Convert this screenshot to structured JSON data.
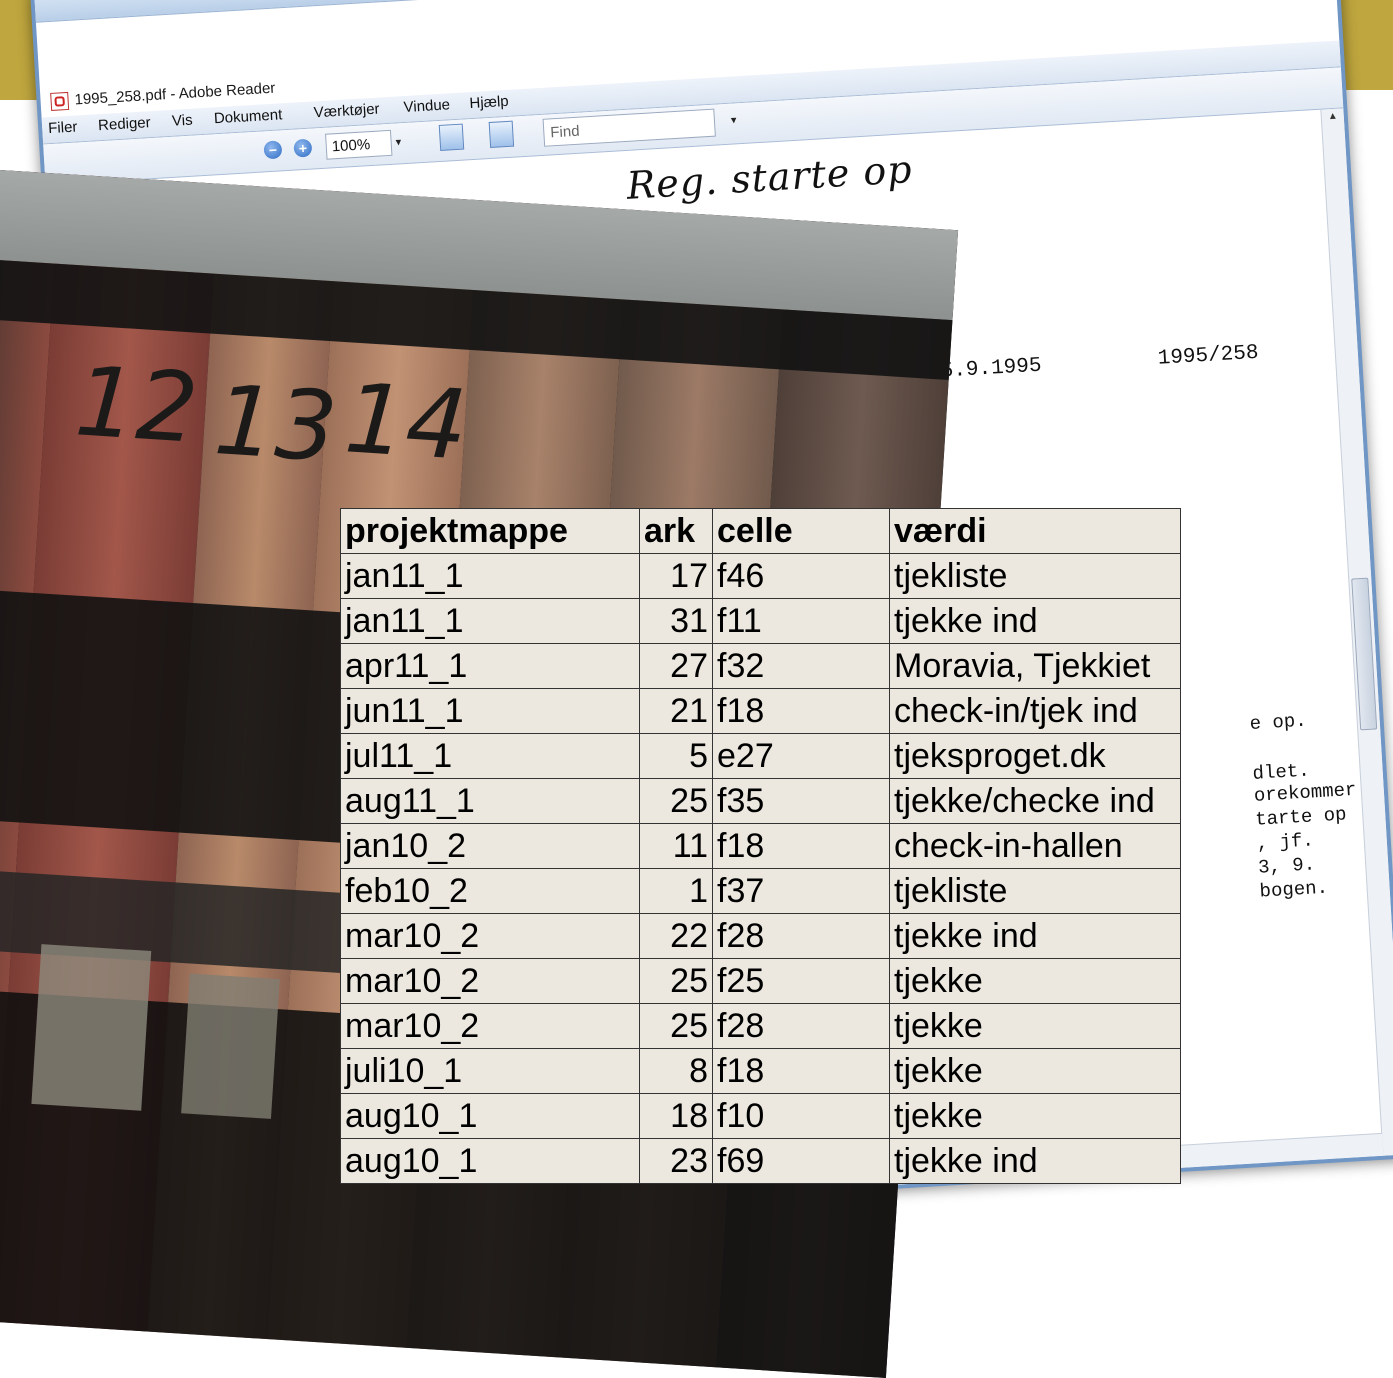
{
  "window": {
    "title": "1995_258.pdf - Adobe Reader",
    "close_glyph": "×"
  },
  "menu": [
    "Filer",
    "Rediger",
    "Vis",
    "Dokument",
    "Værktøjer",
    "Vindue",
    "Hjælp"
  ],
  "toolbar": {
    "zoom_out_glyph": "−",
    "zoom_in_glyph": "+",
    "zoom_value": "100%",
    "dropdown_glyph": "▾",
    "find_placeholder": "Find",
    "find_dropdown_glyph": "▾",
    "icons": [
      "fit-width-icon",
      "fit-page-icon"
    ]
  },
  "document": {
    "handwriting": "Reg. starte op",
    "date": "25.9.1995",
    "case_number": "1995/258",
    "body_lines": [
      "e op.",
      "dlet.",
      "orekommer",
      "tarte op",
      ", jf.",
      "3, 9.",
      "bogen."
    ]
  },
  "photo": {
    "spine_numbers": [
      "12",
      "13",
      "14"
    ],
    "spine_colors": [
      "#8c4a3f",
      "#a0705c",
      "#b88a6a",
      "#c29274",
      "#a8826a",
      "#9c7a66",
      "#6e5a50"
    ]
  },
  "table": {
    "columns": [
      "projektmappe",
      "ark",
      "celle",
      "værdi"
    ],
    "rows": [
      {
        "projektmappe": "jan11_1",
        "ark": "17",
        "celle": "f46",
        "vaerdi": "tjekliste"
      },
      {
        "projektmappe": "jan11_1",
        "ark": "31",
        "celle": "f11",
        "vaerdi": "tjekke ind"
      },
      {
        "projektmappe": "apr11_1",
        "ark": "27",
        "celle": "f32",
        "vaerdi": "Moravia, Tjekkiet"
      },
      {
        "projektmappe": "jun11_1",
        "ark": "21",
        "celle": "f18",
        "vaerdi": "check-in/tjek ind"
      },
      {
        "projektmappe": "jul11_1",
        "ark": "5",
        "celle": "e27",
        "vaerdi": "tjeksproget.dk"
      },
      {
        "projektmappe": "aug11_1",
        "ark": "25",
        "celle": "f35",
        "vaerdi": "tjekke/checke ind"
      },
      {
        "projektmappe": "jan10_2",
        "ark": "11",
        "celle": "f18",
        "vaerdi": "check-in-hallen"
      },
      {
        "projektmappe": "feb10_2",
        "ark": "1",
        "celle": "f37",
        "vaerdi": "tjekliste"
      },
      {
        "projektmappe": "mar10_2",
        "ark": "22",
        "celle": "f28",
        "vaerdi": "tjekke ind"
      },
      {
        "projektmappe": "mar10_2",
        "ark": "25",
        "celle": "f25",
        "vaerdi": "tjekke"
      },
      {
        "projektmappe": "mar10_2",
        "ark": "25",
        "celle": "f28",
        "vaerdi": "tjekke"
      },
      {
        "projektmappe": "juli10_1",
        "ark": "8",
        "celle": "f18",
        "vaerdi": "tjekke"
      },
      {
        "projektmappe": "aug10_1",
        "ark": "18",
        "celle": "f10",
        "vaerdi": "tjekke"
      },
      {
        "projektmappe": "aug10_1",
        "ark": "23",
        "celle": "f69",
        "vaerdi": "tjekke ind"
      }
    ]
  },
  "colors": {
    "gold_band": "#bfa63e",
    "table_bg": "#ece8df",
    "window_border": "#6f96c5"
  }
}
